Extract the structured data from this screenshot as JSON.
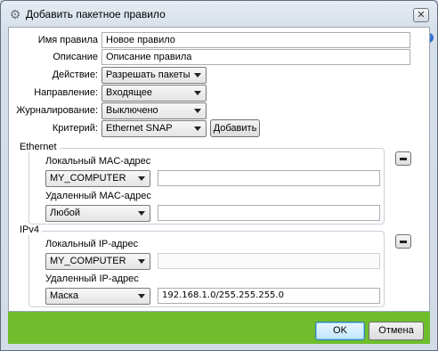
{
  "window": {
    "title": "Добавить пакетное правило",
    "close_glyph": "✕",
    "help_glyph": "?"
  },
  "form": {
    "name": {
      "label": "Имя правила",
      "value": "Новое правило"
    },
    "description": {
      "label": "Описание",
      "value": "Описание правила"
    },
    "action": {
      "label": "Действие:",
      "value": "Разрешать пакеты"
    },
    "direction": {
      "label": "Направление:",
      "value": "Входящее"
    },
    "logging": {
      "label": "Журналирование:",
      "value": "Выключено"
    },
    "criterion": {
      "label": "Критерий:",
      "value": "Ethernet SNAP",
      "add_button": "Добавить"
    }
  },
  "ethernet": {
    "title": "Ethernet",
    "local_mac": {
      "label": "Локальный MAC-адрес",
      "combo": "MY_COMPUTER",
      "value": ""
    },
    "remote_mac": {
      "label": "Удаленный MAC-адрес",
      "combo": "Любой",
      "value": ""
    }
  },
  "ipv4": {
    "title": "IPv4",
    "local_ip": {
      "label": "Локальный IP-адрес",
      "combo": "MY_COMPUTER",
      "value": ""
    },
    "remote_ip": {
      "label": "Удаленный IP-адрес",
      "combo": "Маска",
      "value": "192.168.1.0/255.255.255.0"
    }
  },
  "buttons": {
    "ok": "OK",
    "cancel": "Отмена"
  },
  "colors": {
    "footer": "#6fbd2d",
    "ok_border": "#3c7fb1"
  }
}
